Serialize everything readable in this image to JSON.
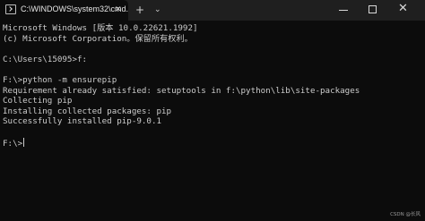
{
  "titlebar": {
    "tab_title": "C:\\WINDOWS\\system32\\cmd.",
    "tab_icon": "terminal-icon",
    "close_tab": "✕",
    "new_tab": "+",
    "dropdown": "⌄"
  },
  "terminal": {
    "lines": [
      "Microsoft Windows [版本 10.0.22621.1992]",
      "(c) Microsoft Corporation。保留所有权利。",
      "",
      "C:\\Users\\15095>f:",
      "",
      "F:\\>python -m ensurepip",
      "Requirement already satisfied: setuptools in f:\\python\\lib\\site-packages",
      "Collecting pip",
      "Installing collected packages: pip",
      "Successfully installed pip-9.0.1",
      "",
      "F:\\>"
    ]
  },
  "watermark": "CSDN @长风",
  "colors": {
    "background": "#0c0c0c",
    "titlebar": "#1f1f1f",
    "text": "#cccccc"
  }
}
